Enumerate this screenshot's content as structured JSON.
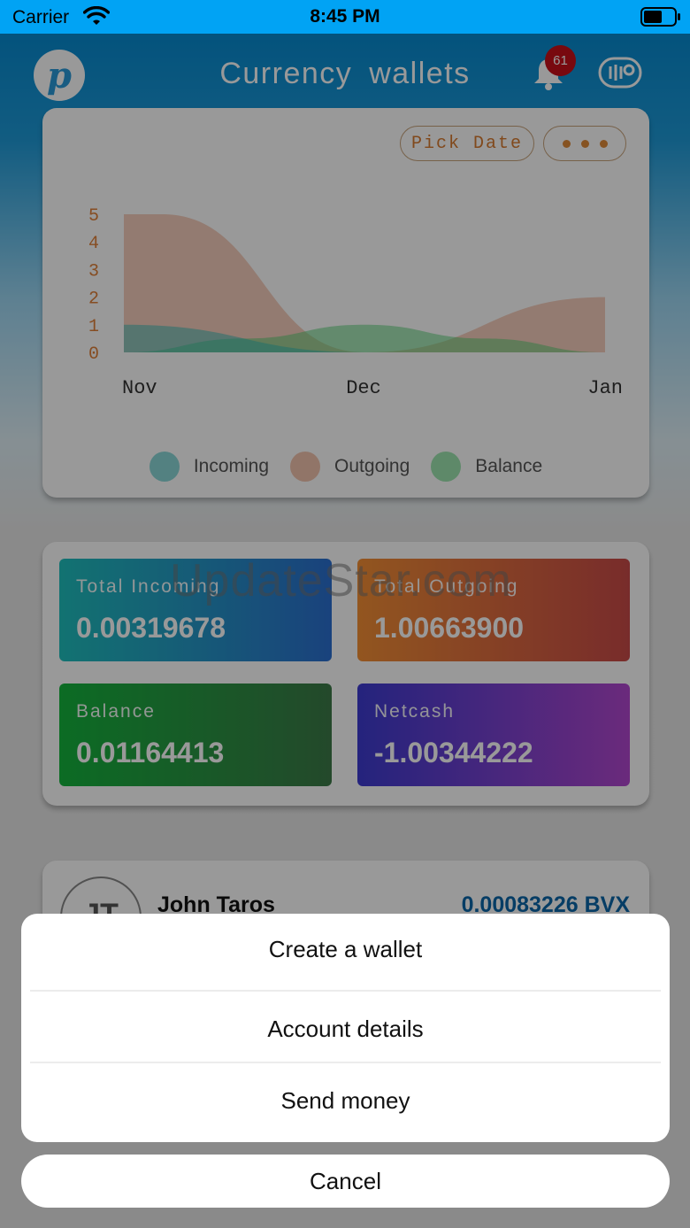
{
  "status_bar": {
    "carrier": "Carrier",
    "time": "8:45 PM"
  },
  "header": {
    "logo_letter": "p",
    "title": "Currency  wallets",
    "notification_count": "61"
  },
  "chart_card": {
    "pick_date_label": "Pick Date",
    "chart_data": {
      "type": "area",
      "x": [
        "Nov",
        "Dec",
        "Jan"
      ],
      "ylim": [
        0,
        5
      ],
      "yticks": [
        "0",
        "1",
        "2",
        "3",
        "4",
        "5"
      ],
      "series": [
        {
          "name": "Incoming",
          "color": "#2ab7b6",
          "points": [
            [
              0,
              1
            ],
            [
              0.5,
              0
            ],
            [
              1,
              0
            ]
          ]
        },
        {
          "name": "Outgoing",
          "color": "#e8926a",
          "points": [
            [
              0,
              5
            ],
            [
              0.08,
              5
            ],
            [
              0.5,
              0
            ],
            [
              1,
              2
            ]
          ]
        },
        {
          "name": "Balance",
          "color": "#4ccd6e",
          "points": [
            [
              0,
              0
            ],
            [
              0.25,
              0.5
            ],
            [
              0.5,
              1
            ],
            [
              0.75,
              0.5
            ],
            [
              1,
              0
            ]
          ]
        }
      ],
      "legend_position": "bottom-center",
      "grid": false
    },
    "legend": [
      {
        "label": "Incoming",
        "color": "#2ab7b6"
      },
      {
        "label": "Outgoing",
        "color": "#e8926a"
      },
      {
        "label": "Balance",
        "color": "#4ccd6e"
      }
    ]
  },
  "stats": {
    "total_incoming": {
      "label": "Total Incoming",
      "value": "0.00319678"
    },
    "total_outgoing": {
      "label": "Total Outgoing",
      "value": "1.00663900"
    },
    "balance": {
      "label": "Balance",
      "value": "0.01164413"
    },
    "netcash": {
      "label": "Netcash",
      "value": "-1.00344222"
    }
  },
  "watermark": "UpdateStar.com",
  "contact": {
    "initials": "JT",
    "name": "John Taros",
    "amount": "0.00083226 BVX"
  },
  "action_sheet": {
    "items": [
      "Create a wallet",
      "Account details",
      "Send money"
    ],
    "cancel": "Cancel"
  }
}
